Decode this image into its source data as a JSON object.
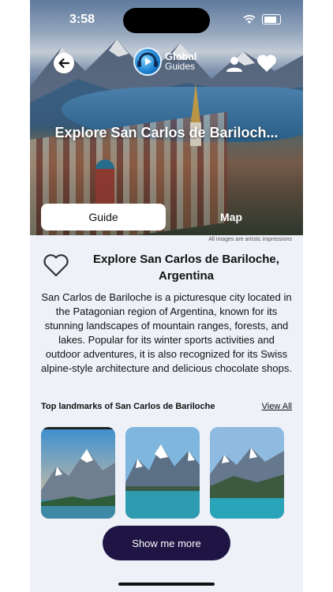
{
  "status": {
    "time": "3:58"
  },
  "header": {
    "logo_line1": "Global",
    "logo_line2": "Guides",
    "hero_title": "Explore San Carlos de Bariloch..."
  },
  "tabs": [
    {
      "label": "Guide",
      "selected": true
    },
    {
      "label": "Map",
      "selected": false
    }
  ],
  "disclaimer": "All images are artistic impressions",
  "place": {
    "title": "Explore San Carlos de Bariloche, Argentina",
    "description": "San Carlos de Bariloche is a picturesque city located in the Patagonian region of Argentina, known for its stunning landscapes of mountain ranges, forests, and lakes. Popular for its winter sports activities and outdoor adventures, it is also recognized for its Swiss alpine-style architecture and delicious chocolate shops."
  },
  "landmarks": {
    "title": "Top  landmarks of San Carlos de Bariloche",
    "view_all": "View All"
  },
  "cta": {
    "label": "Show me more"
  },
  "colors": {
    "cta_bg": "#1f1545",
    "content_bg": "#eef1f7"
  }
}
